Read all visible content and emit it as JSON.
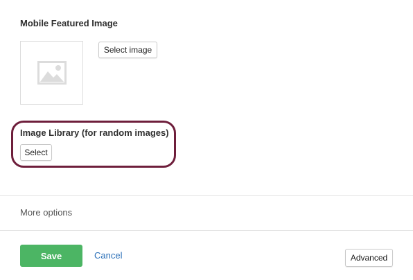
{
  "mobile_featured_image": {
    "title": "Mobile Featured Image",
    "select_image_label": "Select image",
    "placeholder_icon": "image-placeholder-icon"
  },
  "image_library": {
    "title": "Image Library (for random images)",
    "select_label": "Select",
    "highlight_color": "#6e1e3b"
  },
  "more_options": {
    "label": "More options"
  },
  "footer": {
    "save_label": "Save",
    "cancel_label": "Cancel",
    "advanced_label": "Advanced",
    "save_color": "#4cb564",
    "cancel_color": "#2a6fb8"
  }
}
